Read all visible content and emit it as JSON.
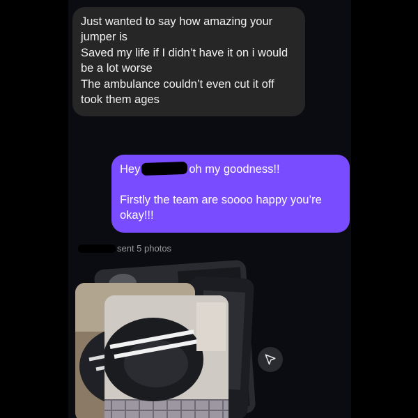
{
  "incoming_message": {
    "lines": [
      "Just wanted to say how amazing your jumper is",
      "Saved my life if I didn’t have it on i would be a lot worse",
      "The ambulance couldn’t even cut it off took them ages"
    ]
  },
  "outgoing_message": {
    "greeting_start": "Hey",
    "greeting_end": "oh my goodness!!",
    "line2": "Firstly the team are soooo happy you’re okay!!!"
  },
  "photos_notice": {
    "text": "sent 5 photos",
    "photo_count": 5
  },
  "icons": {
    "share": "paper-plane-icon"
  },
  "colors": {
    "incoming_bubble": "#262626",
    "outgoing_bubble": "#7a4cff",
    "background": "#0b0c12"
  }
}
